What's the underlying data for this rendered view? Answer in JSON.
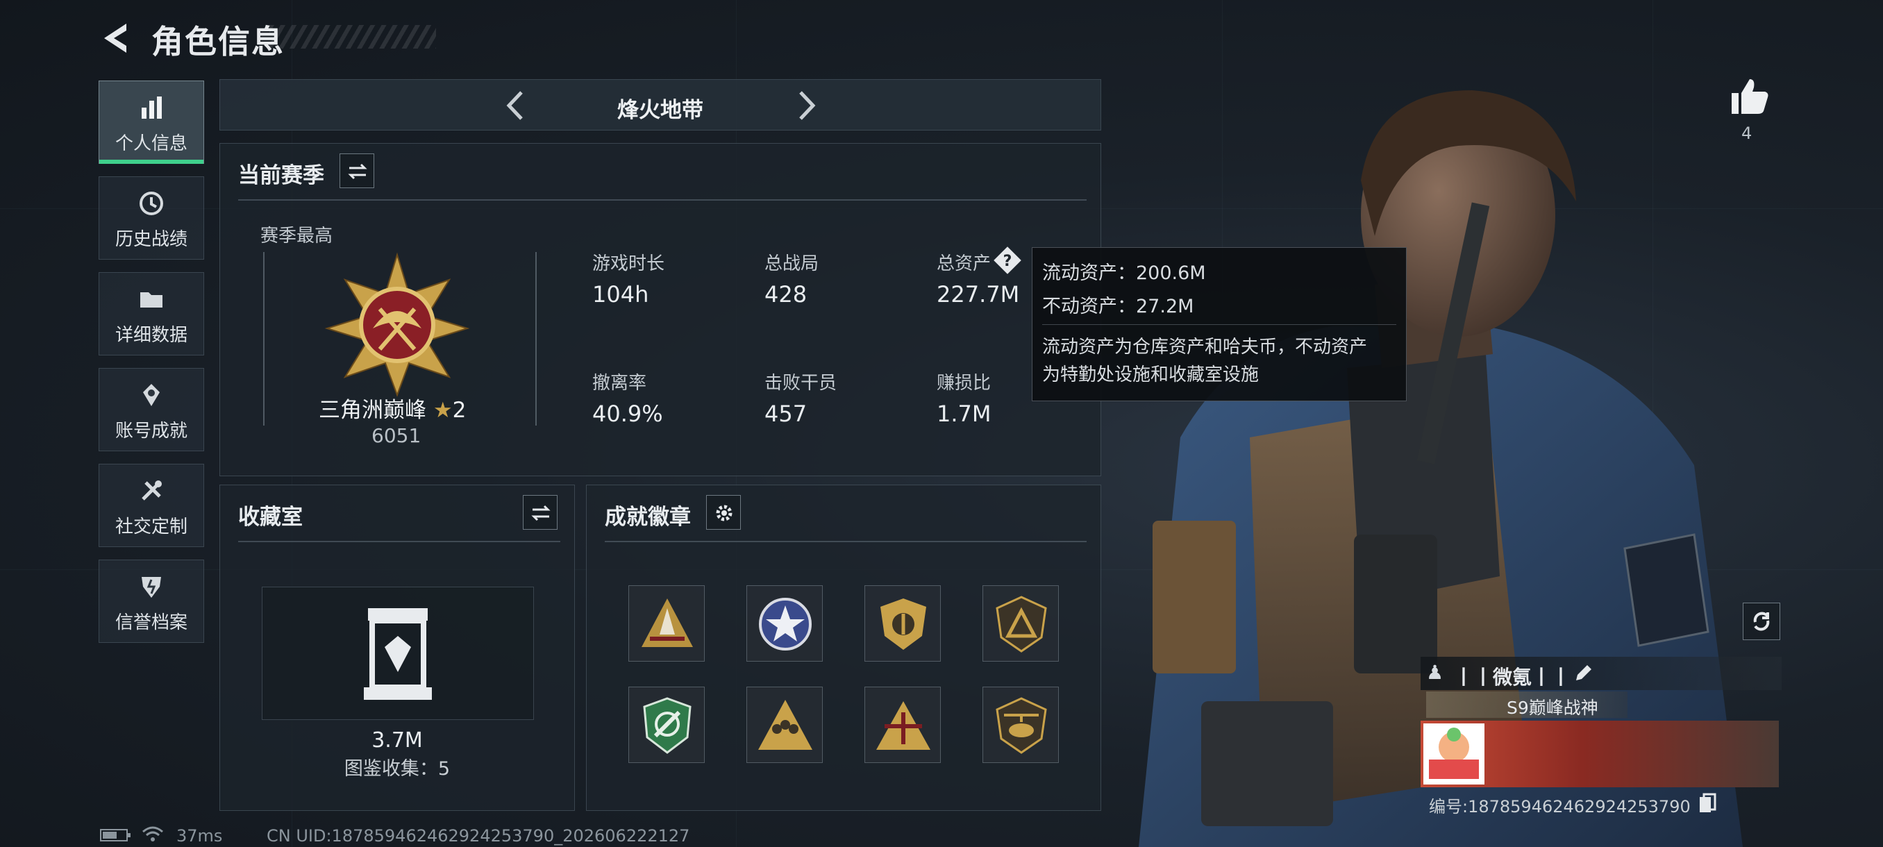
{
  "header": {
    "title": "角色信息"
  },
  "nav": {
    "items": [
      {
        "label": "个人信息",
        "icon": "bar-chart-icon",
        "active": true
      },
      {
        "label": "历史战绩",
        "icon": "history-icon",
        "active": false
      },
      {
        "label": "详细数据",
        "icon": "folder-icon",
        "active": false
      },
      {
        "label": "账号成就",
        "icon": "achievement-icon",
        "active": false
      },
      {
        "label": "社交定制",
        "icon": "tools-icon",
        "active": false
      },
      {
        "label": "信誉档案",
        "icon": "shield-icon",
        "active": false
      }
    ]
  },
  "mode": {
    "label": "烽火地带"
  },
  "season": {
    "title": "当前赛季",
    "best_label": "赛季最高",
    "rank_name": "三角洲巅峰",
    "rank_stars": "2",
    "rank_score": "6051",
    "stats": [
      {
        "label": "游戏时长",
        "value": "104h"
      },
      {
        "label": "总战局",
        "value": "428"
      },
      {
        "label": "总资产",
        "value": "227.7M"
      },
      {
        "label": "撤离率",
        "value": "40.9%"
      },
      {
        "label": "击败干员",
        "value": "457"
      },
      {
        "label": "赚损比",
        "value": "1.7M"
      }
    ]
  },
  "tooltip": {
    "liquid": "流动资产：200.6M",
    "fixed": "不动资产：27.2M",
    "desc1": "流动资产为仓库资产和哈夫币，不动资产",
    "desc2": "为特勤处设施和收藏室设施"
  },
  "collection": {
    "title": "收藏室",
    "value": "3.7M",
    "count": "图鉴收集：5"
  },
  "badges": {
    "title": "成就徽章"
  },
  "likes": {
    "count": "4"
  },
  "profile": {
    "name": "丨丨微氪丨丨",
    "title": "S9巅峰战神",
    "id": "编号:18785946246292425379​0"
  },
  "footer": {
    "ping": "37ms",
    "uid": "CN UID:18785946246292425379​0_202606222127"
  },
  "colors": {
    "accent": "#3fd08c",
    "gold": "#c9a24a"
  }
}
